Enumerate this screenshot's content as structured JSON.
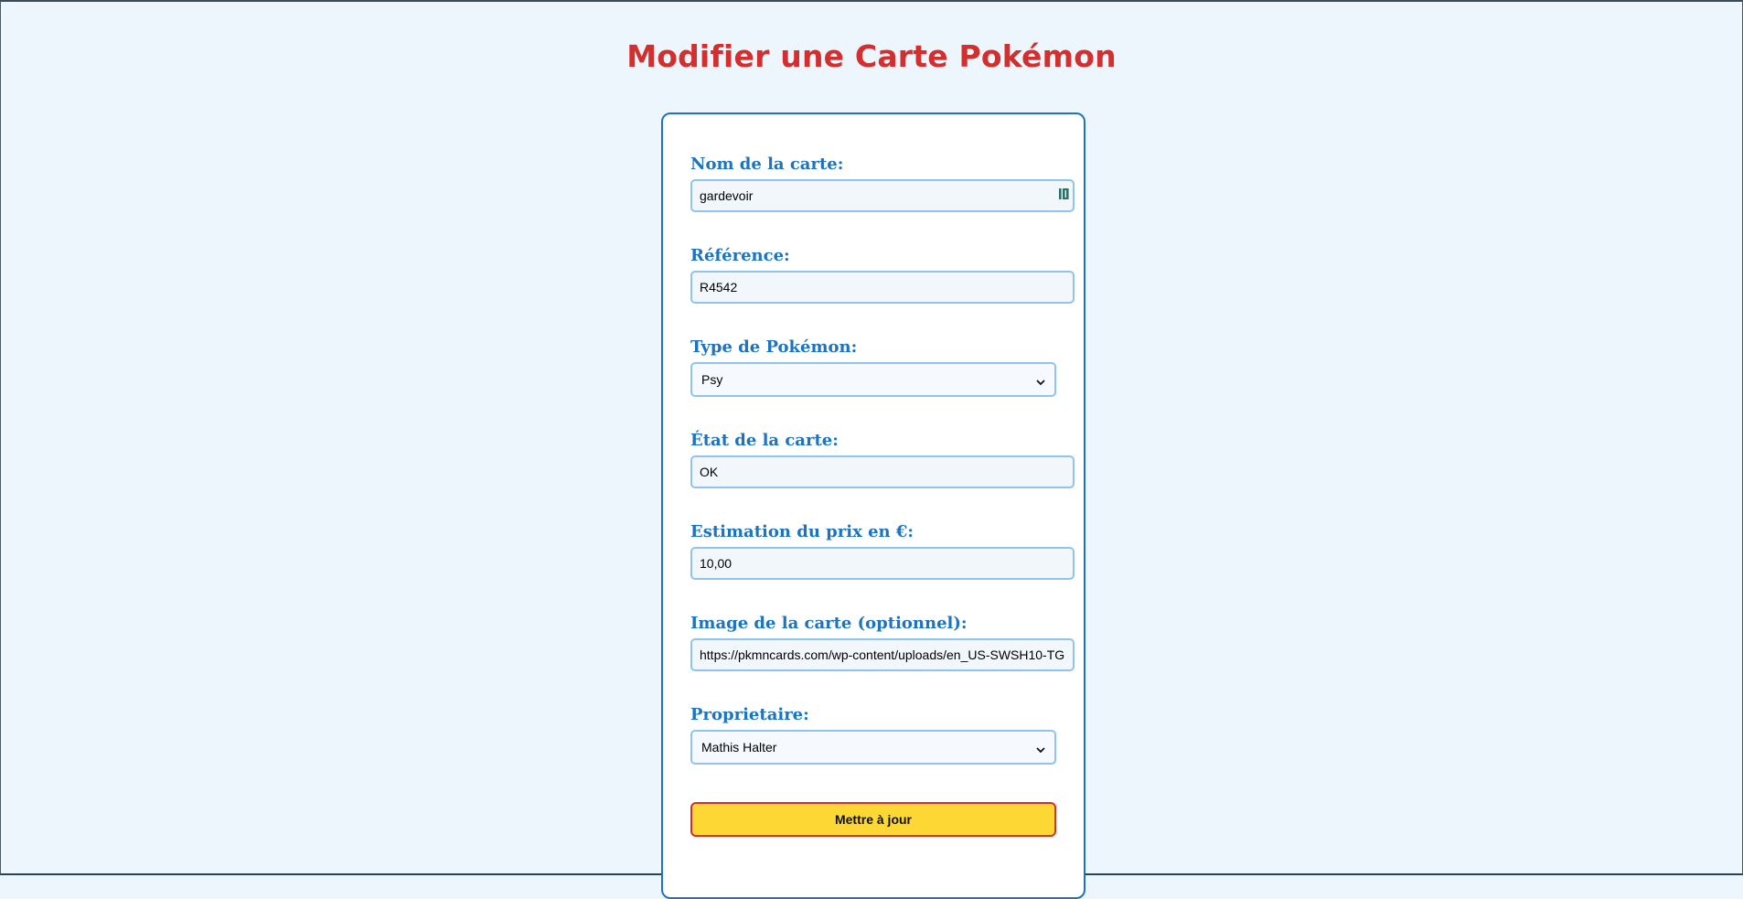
{
  "page": {
    "title": "Modifier une Carte Pokémon"
  },
  "form": {
    "card_name": {
      "label": "Nom de la carte:",
      "value": "gardevoir"
    },
    "reference": {
      "label": "Référence:",
      "value": "R4542"
    },
    "pokemon_type": {
      "label": "Type de Pokémon:",
      "selected": "Psy"
    },
    "card_condition": {
      "label": "État de la carte:",
      "value": "OK"
    },
    "price_estimate": {
      "label": "Estimation du prix en €:",
      "value": "10,00"
    },
    "card_image": {
      "label": "Image de la carte (optionnel):",
      "value": "https://pkmncards.com/wp-content/uploads/en_US-SWSH10-TG"
    },
    "owner": {
      "label": "Proprietaire:",
      "selected": "Mathis Halter"
    },
    "submit_label": "Mettre à jour"
  },
  "icons": {
    "autofill": "password-manager-icon",
    "select_arrow": "chevron-down-icon"
  },
  "colors": {
    "background": "#eef6fd",
    "title": "#d32f2f",
    "card_border": "#1e73be",
    "label": "#1e73be",
    "input_border": "#90c4ee",
    "button_bg": "#fdd835",
    "button_border": "#d32f2f"
  }
}
